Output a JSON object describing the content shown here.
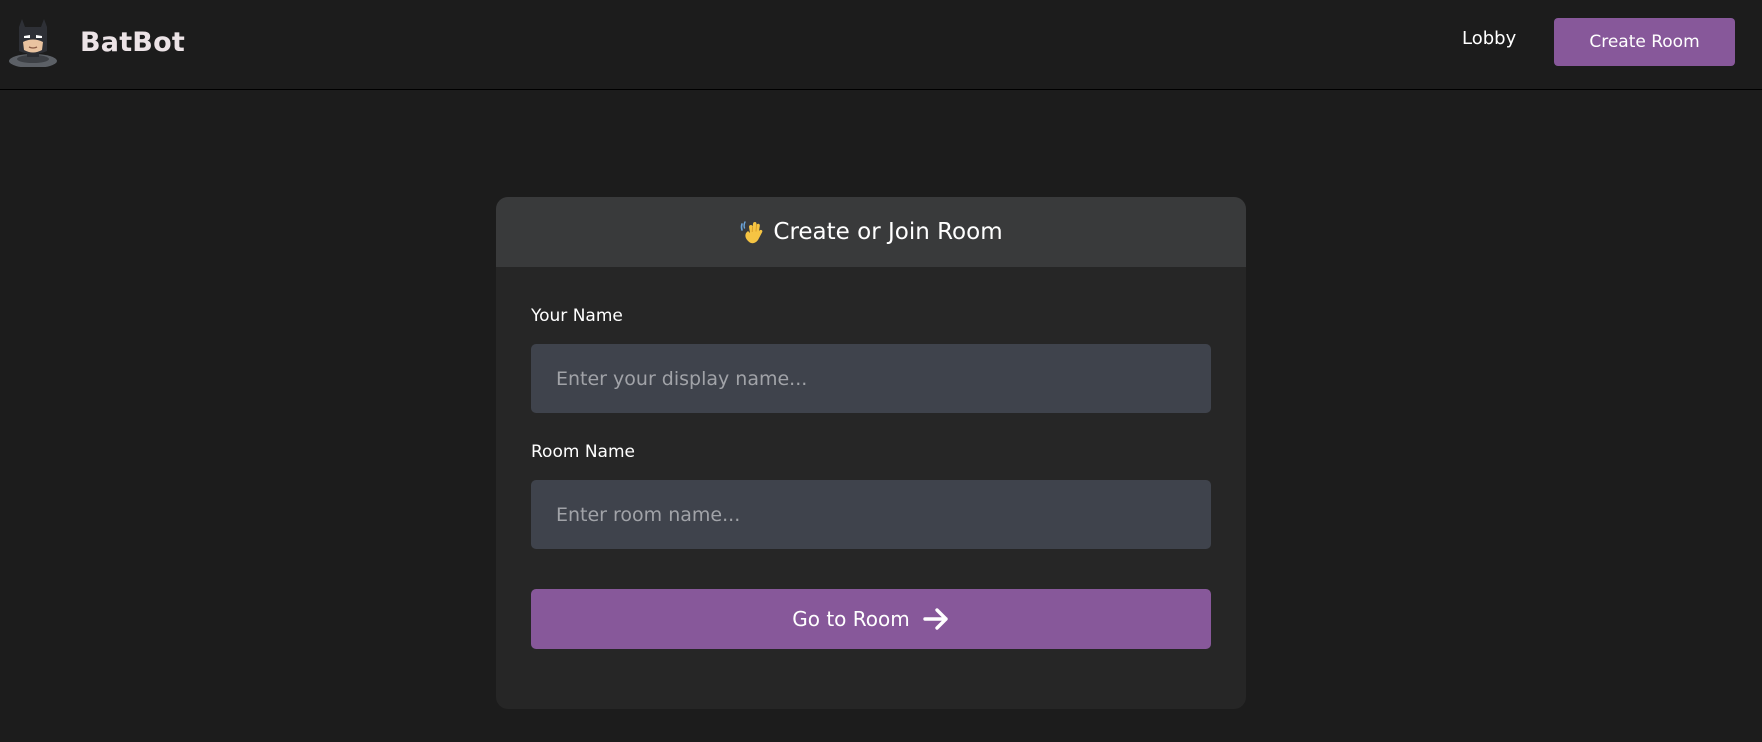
{
  "header": {
    "brand_name": "BatBot",
    "logo_icon": "batman-avatar-icon",
    "nav": {
      "lobby_label": "Lobby",
      "create_room_label": "Create Room"
    }
  },
  "card": {
    "title_icon": "waving-hand-icon",
    "title": "Create or Join Room",
    "name_field": {
      "label": "Your Name",
      "value": "",
      "placeholder": "Enter your display name..."
    },
    "room_field": {
      "label": "Room Name",
      "value": "",
      "placeholder": "Enter room name..."
    },
    "submit": {
      "label": "Go to Room",
      "icon": "arrow-right-icon"
    }
  },
  "colors": {
    "background": "#1c1c1c",
    "card_body": "#262626",
    "card_header": "#393a3b",
    "input_background": "#3f434c",
    "accent": "#87589a",
    "brand_text": "#ece3e6"
  }
}
